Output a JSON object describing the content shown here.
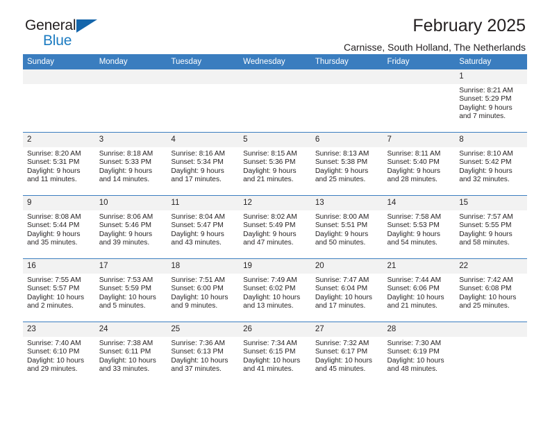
{
  "brand": {
    "name_part1": "General",
    "name_part2": "Blue"
  },
  "header": {
    "title": "February 2025",
    "subtitle": "Carnisse, South Holland, The Netherlands"
  },
  "colors": {
    "header_blue": "#3a7dbf",
    "logo_blue": "#1b7bc1",
    "daynum_gray": "#f2f2f2",
    "text": "#231f20"
  },
  "weekdays": [
    "Sunday",
    "Monday",
    "Tuesday",
    "Wednesday",
    "Thursday",
    "Friday",
    "Saturday"
  ],
  "weeks": [
    [
      {
        "day": "",
        "sunrise": "",
        "sunset": "",
        "daylight1": "",
        "daylight2": ""
      },
      {
        "day": "",
        "sunrise": "",
        "sunset": "",
        "daylight1": "",
        "daylight2": ""
      },
      {
        "day": "",
        "sunrise": "",
        "sunset": "",
        "daylight1": "",
        "daylight2": ""
      },
      {
        "day": "",
        "sunrise": "",
        "sunset": "",
        "daylight1": "",
        "daylight2": ""
      },
      {
        "day": "",
        "sunrise": "",
        "sunset": "",
        "daylight1": "",
        "daylight2": ""
      },
      {
        "day": "",
        "sunrise": "",
        "sunset": "",
        "daylight1": "",
        "daylight2": ""
      },
      {
        "day": "1",
        "sunrise": "Sunrise: 8:21 AM",
        "sunset": "Sunset: 5:29 PM",
        "daylight1": "Daylight: 9 hours",
        "daylight2": "and 7 minutes."
      }
    ],
    [
      {
        "day": "2",
        "sunrise": "Sunrise: 8:20 AM",
        "sunset": "Sunset: 5:31 PM",
        "daylight1": "Daylight: 9 hours",
        "daylight2": "and 11 minutes."
      },
      {
        "day": "3",
        "sunrise": "Sunrise: 8:18 AM",
        "sunset": "Sunset: 5:33 PM",
        "daylight1": "Daylight: 9 hours",
        "daylight2": "and 14 minutes."
      },
      {
        "day": "4",
        "sunrise": "Sunrise: 8:16 AM",
        "sunset": "Sunset: 5:34 PM",
        "daylight1": "Daylight: 9 hours",
        "daylight2": "and 17 minutes."
      },
      {
        "day": "5",
        "sunrise": "Sunrise: 8:15 AM",
        "sunset": "Sunset: 5:36 PM",
        "daylight1": "Daylight: 9 hours",
        "daylight2": "and 21 minutes."
      },
      {
        "day": "6",
        "sunrise": "Sunrise: 8:13 AM",
        "sunset": "Sunset: 5:38 PM",
        "daylight1": "Daylight: 9 hours",
        "daylight2": "and 25 minutes."
      },
      {
        "day": "7",
        "sunrise": "Sunrise: 8:11 AM",
        "sunset": "Sunset: 5:40 PM",
        "daylight1": "Daylight: 9 hours",
        "daylight2": "and 28 minutes."
      },
      {
        "day": "8",
        "sunrise": "Sunrise: 8:10 AM",
        "sunset": "Sunset: 5:42 PM",
        "daylight1": "Daylight: 9 hours",
        "daylight2": "and 32 minutes."
      }
    ],
    [
      {
        "day": "9",
        "sunrise": "Sunrise: 8:08 AM",
        "sunset": "Sunset: 5:44 PM",
        "daylight1": "Daylight: 9 hours",
        "daylight2": "and 35 minutes."
      },
      {
        "day": "10",
        "sunrise": "Sunrise: 8:06 AM",
        "sunset": "Sunset: 5:46 PM",
        "daylight1": "Daylight: 9 hours",
        "daylight2": "and 39 minutes."
      },
      {
        "day": "11",
        "sunrise": "Sunrise: 8:04 AM",
        "sunset": "Sunset: 5:47 PM",
        "daylight1": "Daylight: 9 hours",
        "daylight2": "and 43 minutes."
      },
      {
        "day": "12",
        "sunrise": "Sunrise: 8:02 AM",
        "sunset": "Sunset: 5:49 PM",
        "daylight1": "Daylight: 9 hours",
        "daylight2": "and 47 minutes."
      },
      {
        "day": "13",
        "sunrise": "Sunrise: 8:00 AM",
        "sunset": "Sunset: 5:51 PM",
        "daylight1": "Daylight: 9 hours",
        "daylight2": "and 50 minutes."
      },
      {
        "day": "14",
        "sunrise": "Sunrise: 7:58 AM",
        "sunset": "Sunset: 5:53 PM",
        "daylight1": "Daylight: 9 hours",
        "daylight2": "and 54 minutes."
      },
      {
        "day": "15",
        "sunrise": "Sunrise: 7:57 AM",
        "sunset": "Sunset: 5:55 PM",
        "daylight1": "Daylight: 9 hours",
        "daylight2": "and 58 minutes."
      }
    ],
    [
      {
        "day": "16",
        "sunrise": "Sunrise: 7:55 AM",
        "sunset": "Sunset: 5:57 PM",
        "daylight1": "Daylight: 10 hours",
        "daylight2": "and 2 minutes."
      },
      {
        "day": "17",
        "sunrise": "Sunrise: 7:53 AM",
        "sunset": "Sunset: 5:59 PM",
        "daylight1": "Daylight: 10 hours",
        "daylight2": "and 5 minutes."
      },
      {
        "day": "18",
        "sunrise": "Sunrise: 7:51 AM",
        "sunset": "Sunset: 6:00 PM",
        "daylight1": "Daylight: 10 hours",
        "daylight2": "and 9 minutes."
      },
      {
        "day": "19",
        "sunrise": "Sunrise: 7:49 AM",
        "sunset": "Sunset: 6:02 PM",
        "daylight1": "Daylight: 10 hours",
        "daylight2": "and 13 minutes."
      },
      {
        "day": "20",
        "sunrise": "Sunrise: 7:47 AM",
        "sunset": "Sunset: 6:04 PM",
        "daylight1": "Daylight: 10 hours",
        "daylight2": "and 17 minutes."
      },
      {
        "day": "21",
        "sunrise": "Sunrise: 7:44 AM",
        "sunset": "Sunset: 6:06 PM",
        "daylight1": "Daylight: 10 hours",
        "daylight2": "and 21 minutes."
      },
      {
        "day": "22",
        "sunrise": "Sunrise: 7:42 AM",
        "sunset": "Sunset: 6:08 PM",
        "daylight1": "Daylight: 10 hours",
        "daylight2": "and 25 minutes."
      }
    ],
    [
      {
        "day": "23",
        "sunrise": "Sunrise: 7:40 AM",
        "sunset": "Sunset: 6:10 PM",
        "daylight1": "Daylight: 10 hours",
        "daylight2": "and 29 minutes."
      },
      {
        "day": "24",
        "sunrise": "Sunrise: 7:38 AM",
        "sunset": "Sunset: 6:11 PM",
        "daylight1": "Daylight: 10 hours",
        "daylight2": "and 33 minutes."
      },
      {
        "day": "25",
        "sunrise": "Sunrise: 7:36 AM",
        "sunset": "Sunset: 6:13 PM",
        "daylight1": "Daylight: 10 hours",
        "daylight2": "and 37 minutes."
      },
      {
        "day": "26",
        "sunrise": "Sunrise: 7:34 AM",
        "sunset": "Sunset: 6:15 PM",
        "daylight1": "Daylight: 10 hours",
        "daylight2": "and 41 minutes."
      },
      {
        "day": "27",
        "sunrise": "Sunrise: 7:32 AM",
        "sunset": "Sunset: 6:17 PM",
        "daylight1": "Daylight: 10 hours",
        "daylight2": "and 45 minutes."
      },
      {
        "day": "28",
        "sunrise": "Sunrise: 7:30 AM",
        "sunset": "Sunset: 6:19 PM",
        "daylight1": "Daylight: 10 hours",
        "daylight2": "and 48 minutes."
      },
      {
        "day": "",
        "sunrise": "",
        "sunset": "",
        "daylight1": "",
        "daylight2": ""
      }
    ]
  ]
}
